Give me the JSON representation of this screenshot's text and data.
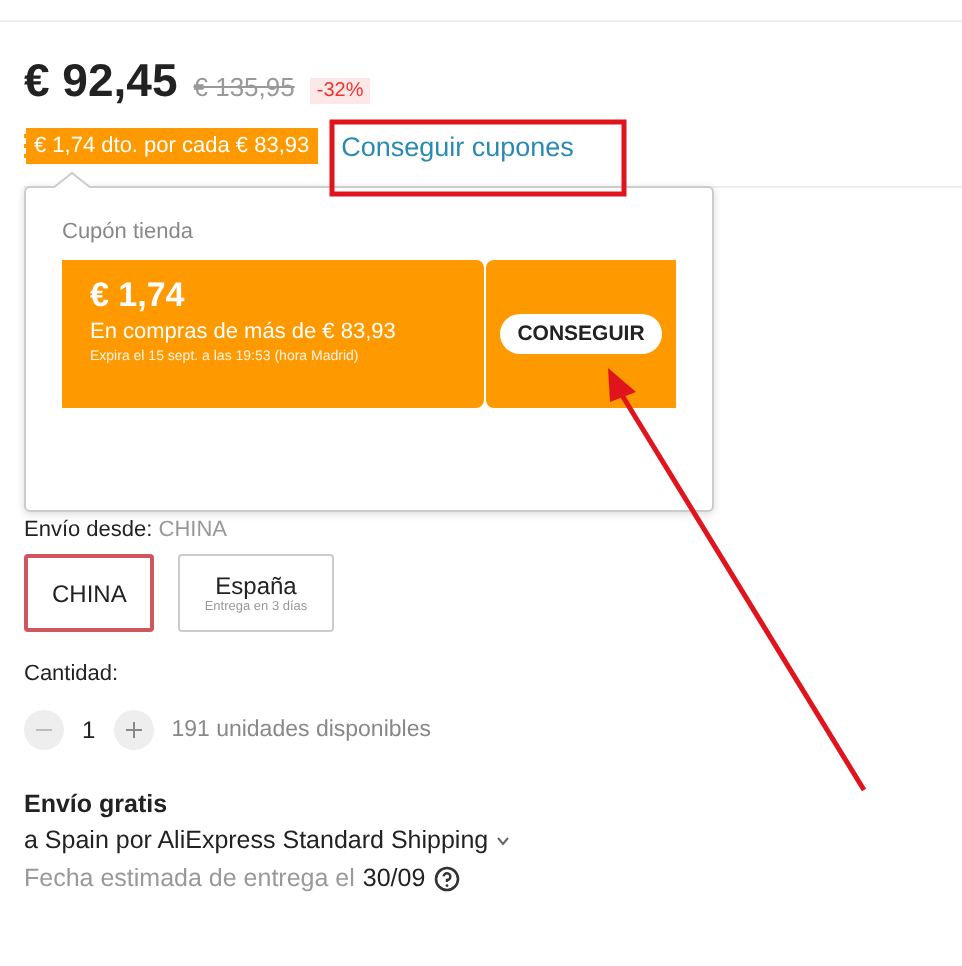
{
  "price": {
    "current": "€ 92,45",
    "original": "€ 135,95",
    "discount": "-32%"
  },
  "coupon_bar": {
    "label": "€ 1,74 dto. por cada € 83,93",
    "link": "Conseguir cupones"
  },
  "coupon_popup": {
    "title": "Cupón tienda",
    "coupon": {
      "amount": "€ 1,74",
      "condition": "En compras de más de € 83,93",
      "expiry": "Expira el 15 sept. a las 19:53 (hora Madrid)",
      "button": "CONSEGUIR"
    }
  },
  "ship_from": {
    "label": "Envío desde:",
    "value": "CHINA",
    "options": [
      {
        "name": "CHINA",
        "selected": true
      },
      {
        "name": "España",
        "note": "Entrega en 3 días",
        "selected": false
      }
    ]
  },
  "quantity": {
    "label": "Cantidad:",
    "value": "1",
    "available": "191 unidades disponibles"
  },
  "shipping": {
    "title": "Envío gratis",
    "method": "a Spain por AliExpress Standard Shipping",
    "estimate_label": "Fecha estimada de entrega el",
    "estimate_date": "30/09"
  }
}
